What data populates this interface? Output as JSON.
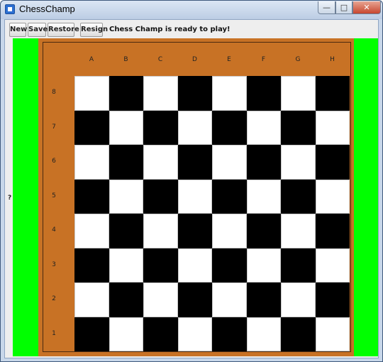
{
  "window": {
    "title": "ChessChamp",
    "controls": {
      "minimize": "—",
      "maximize": "□",
      "close": "✕"
    }
  },
  "toolbar": {
    "new_label": "New",
    "save_label": "Save",
    "restore_label": "Restore",
    "resign_label": "Resign",
    "status": "Chess Champ is ready to play!"
  },
  "side_indicator": "?",
  "board": {
    "files": [
      "A",
      "B",
      "C",
      "D",
      "E",
      "F",
      "G",
      "H"
    ],
    "ranks": [
      "8",
      "7",
      "6",
      "5",
      "4",
      "3",
      "2",
      "1"
    ]
  },
  "colors": {
    "background_panel": "#00ff00",
    "frame": "#c87225",
    "light_square": "#ffffff",
    "dark_square": "#000000"
  }
}
